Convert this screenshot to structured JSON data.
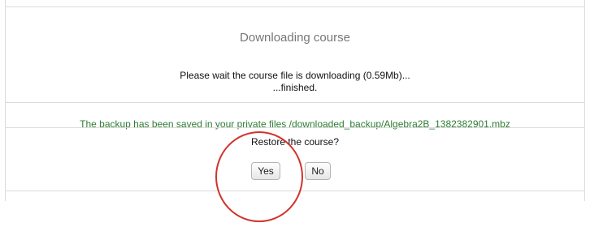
{
  "dialog": {
    "title": "Downloading course",
    "wait_message": "Please wait the course file is downloading (0.59Mb)...",
    "finished_message": "...finished.",
    "saved_message": "The backup has been saved in your private files /downloaded_backup/Algebra2B_1382382901.mbz"
  },
  "restore": {
    "question": "Restore the course?",
    "yes_label": "Yes",
    "no_label": "No"
  },
  "colors": {
    "heading": "#777777",
    "success_text": "#2e7d32",
    "annotation_circle": "#d0342c"
  }
}
